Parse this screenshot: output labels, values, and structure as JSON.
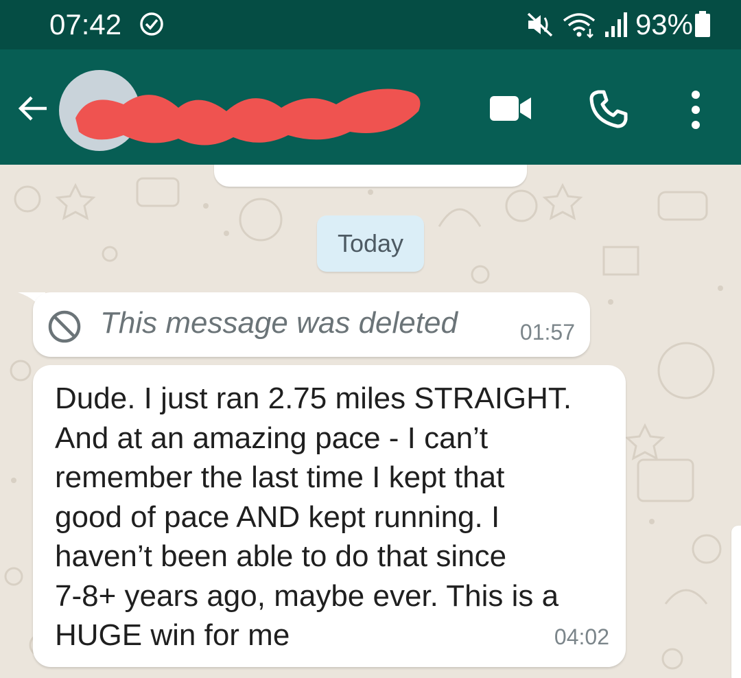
{
  "status_bar": {
    "time": "07:42",
    "battery": "93%",
    "icons": [
      "check-circle-icon",
      "mute-icon",
      "wifi-icon",
      "signal-icon",
      "battery-icon"
    ]
  },
  "header": {
    "contact_name_redacted": true,
    "actions": [
      "back-arrow-icon",
      "video-call-icon",
      "voice-call-icon",
      "more-vert-icon"
    ]
  },
  "colors": {
    "status_bar": "#054d44",
    "app_bar": "#075e54",
    "chat_bg": "#ebe5dc",
    "redaction": "#ef5350",
    "date_chip": "#dbeef7"
  },
  "chat": {
    "date_chip": "Today",
    "messages": [
      {
        "type": "deleted",
        "text": "This message was deleted",
        "time": "01:57"
      },
      {
        "type": "text",
        "lines": [
          "Dude. I just ran 2.75 miles STRAIGHT.",
          "And at an amazing pace - I can’t",
          "remember the last time I kept that",
          "good of pace AND kept running. I",
          "haven’t been able to do that since",
          "7-8+ years ago, maybe ever. This is a",
          "HUGE win for me"
        ],
        "time": "04:02"
      }
    ]
  }
}
